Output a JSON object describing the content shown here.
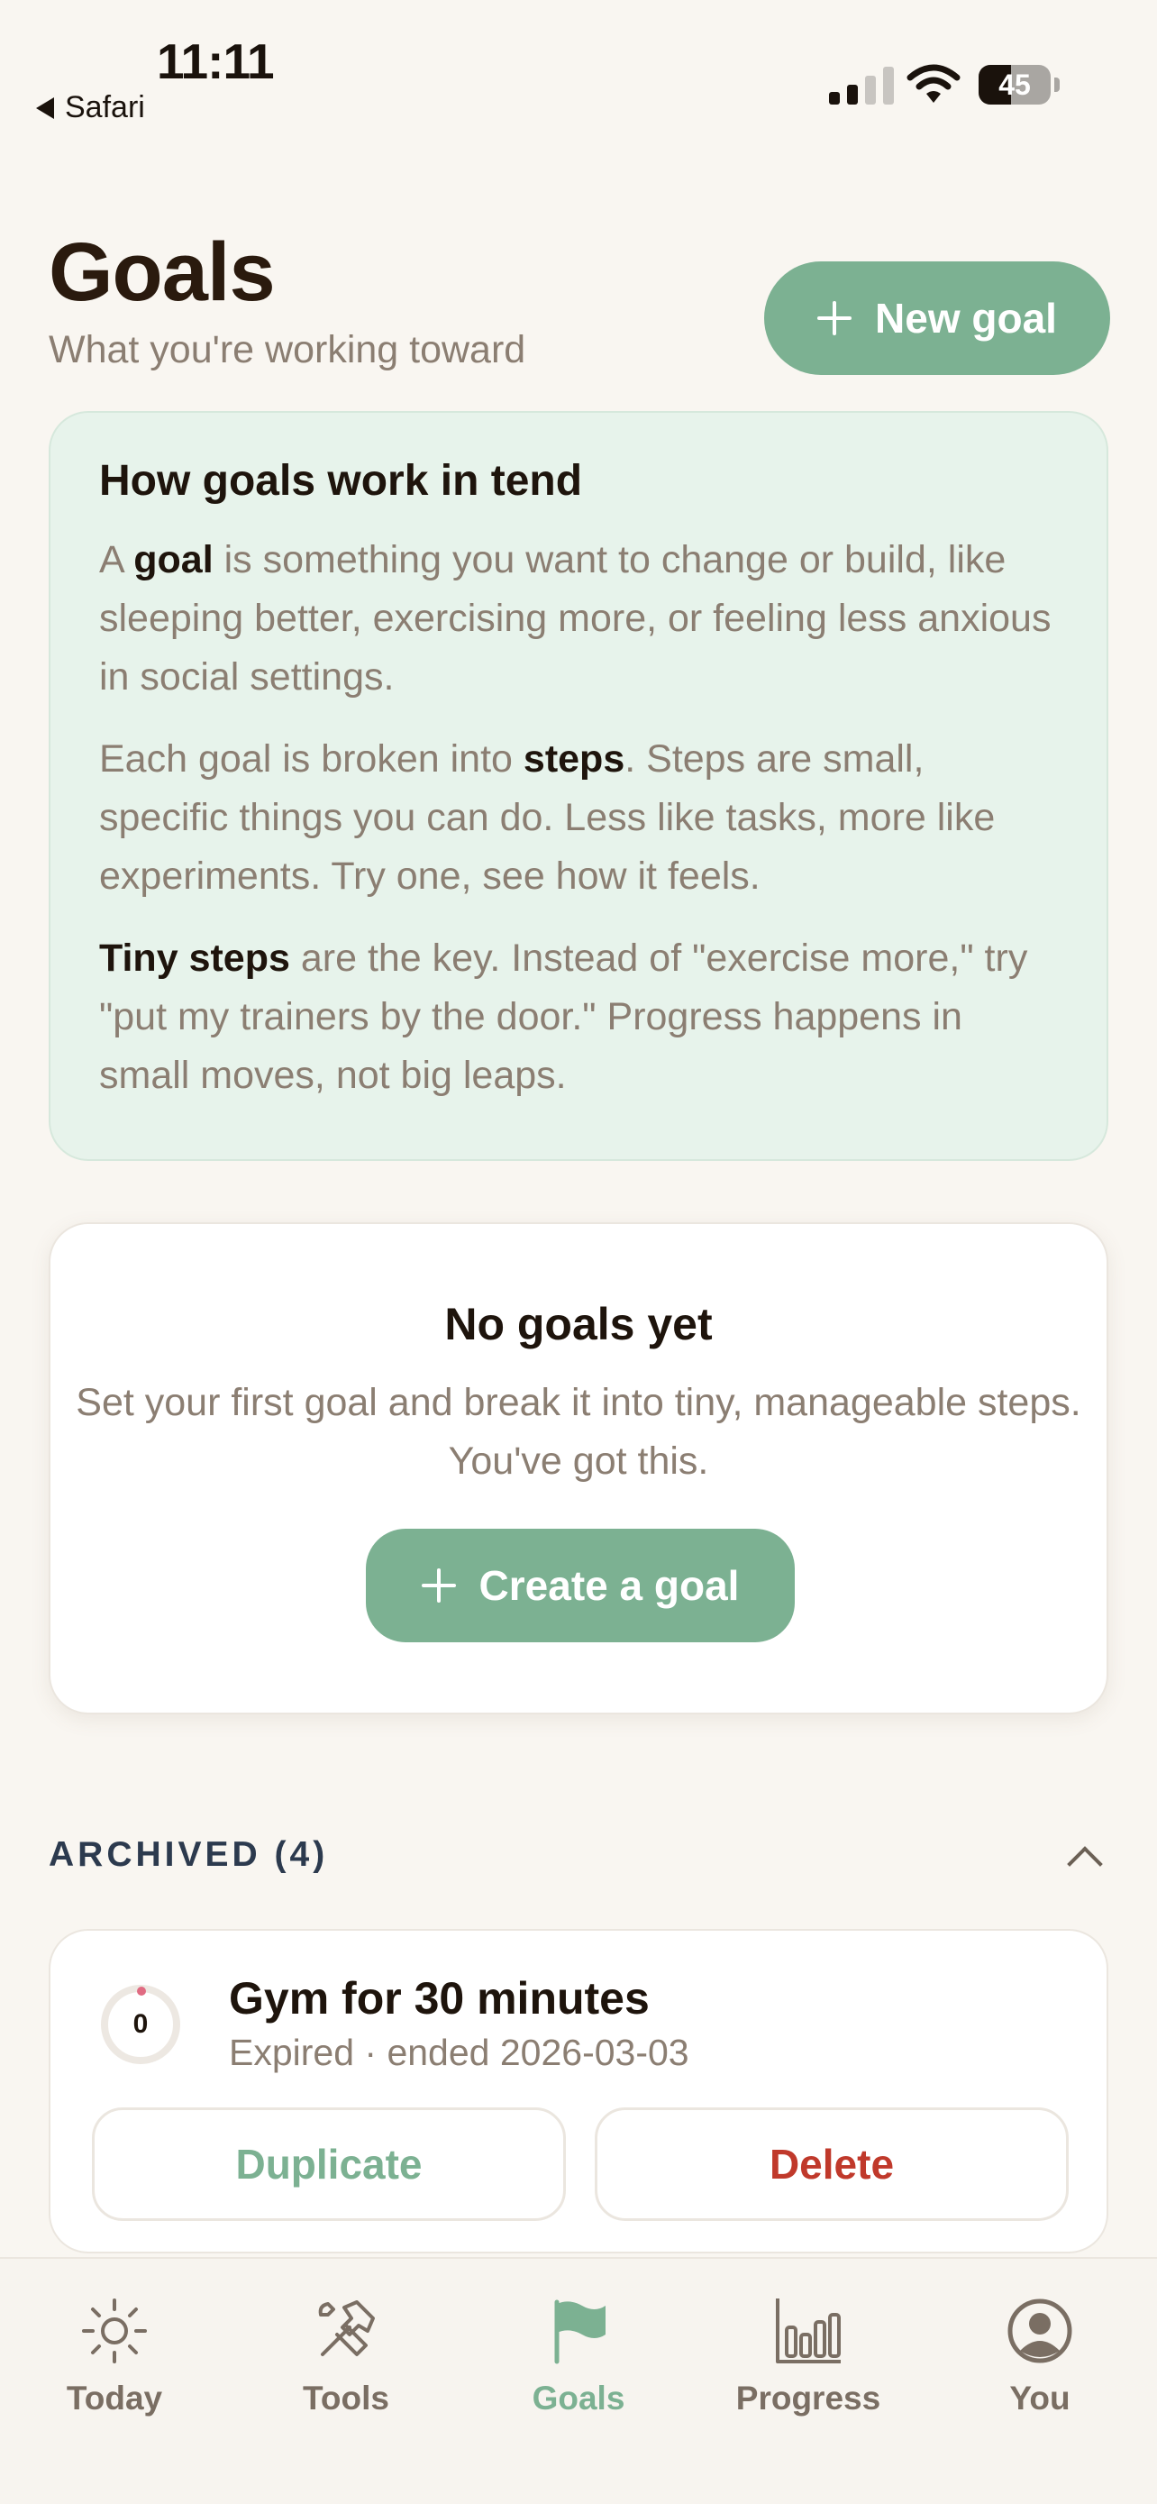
{
  "status_bar": {
    "time": "11:11",
    "back_app": "Safari",
    "battery": "45",
    "battery_level": 0.45
  },
  "header": {
    "title": "Goals",
    "subtitle": "What you're working toward",
    "new_goal_label": "New goal"
  },
  "info_card": {
    "title": "How goals work in tend",
    "p1_pre": "A ",
    "p1_bold": "goal",
    "p1_post": " is something you want to change or build, like sleeping better, exercising more, or feeling less anxious in social settings.",
    "p2_pre": "Each goal is broken into ",
    "p2_bold": "steps",
    "p2_post": ". Steps are small, specific things you can do. Less like tasks, more like experiments. Try one, see how it feels.",
    "p3_bold": "Tiny steps",
    "p3_post": " are the key. Instead of \"exercise more,\" try \"put my trainers by the door.\" Progress happens in small moves, not big leaps."
  },
  "empty_state": {
    "title": "No goals yet",
    "text": "Set your first goal and break it into tiny, manageable steps. You've got this.",
    "create_label": "Create a goal"
  },
  "archived": {
    "header": "ARCHIVED (4)",
    "items": [
      {
        "progress": "0",
        "name": "Gym for 30 minutes",
        "status": "Expired · ended 2026-03-03",
        "duplicate_label": "Duplicate",
        "delete_label": "Delete"
      }
    ]
  },
  "tabs": [
    {
      "label": "Today",
      "icon": "sun-icon"
    },
    {
      "label": "Tools",
      "icon": "tools-icon"
    },
    {
      "label": "Goals",
      "icon": "flag-icon",
      "active": true
    },
    {
      "label": "Progress",
      "icon": "bar-chart-icon"
    },
    {
      "label": "You",
      "icon": "user-icon"
    }
  ],
  "colors": {
    "accent": "#7cb192",
    "danger": "#c0392b",
    "background": "#f9f6f1",
    "info_card": "#e7f3eb"
  }
}
